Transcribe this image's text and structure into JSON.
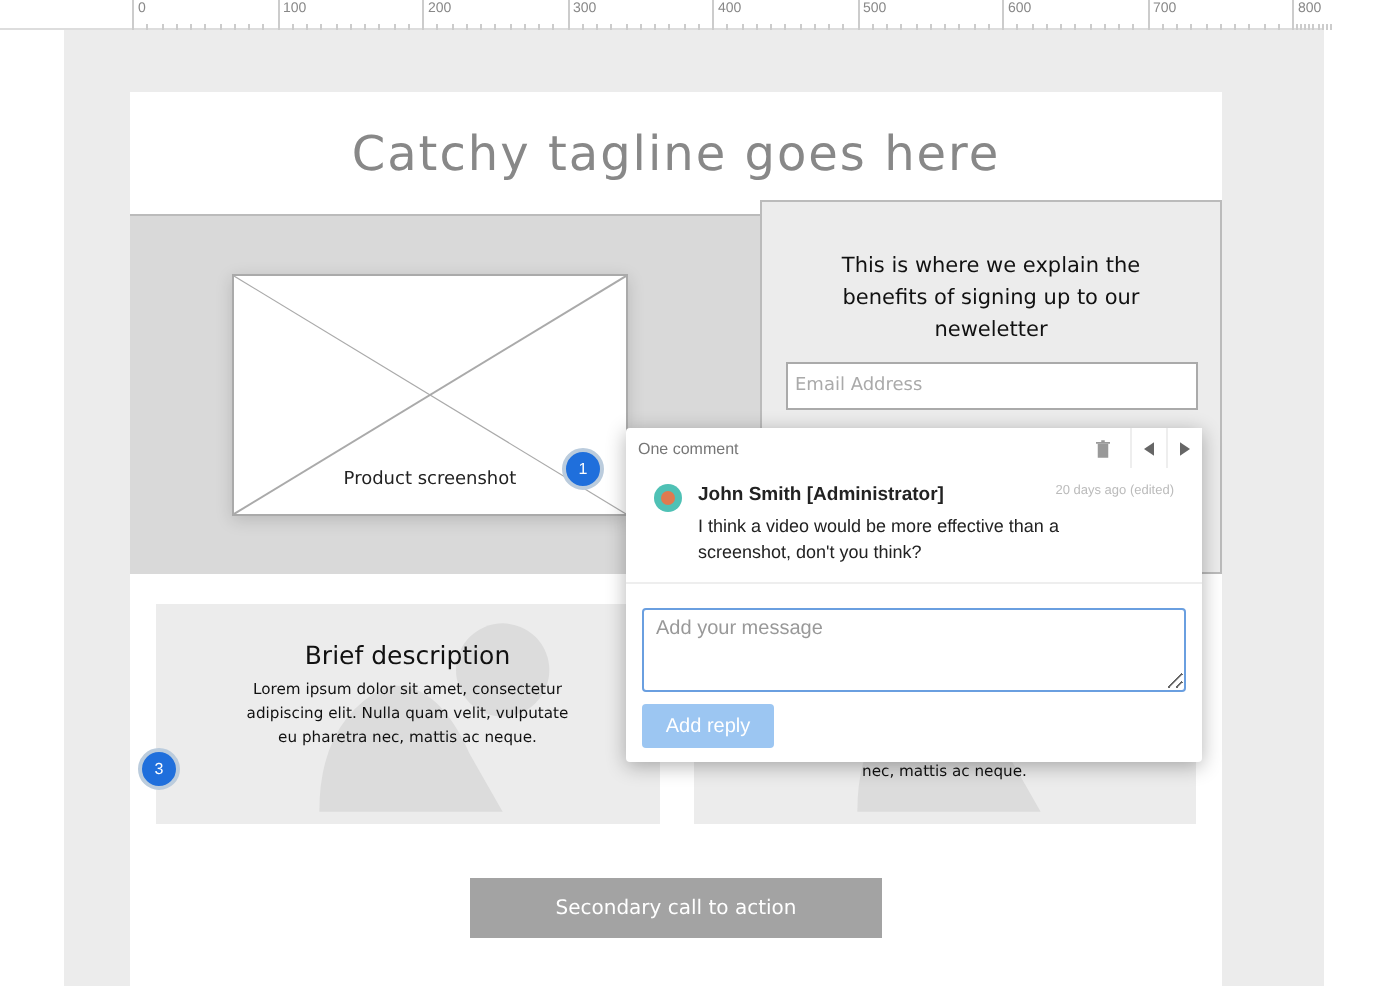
{
  "ruler": {
    "labels": [
      "0",
      "100",
      "200",
      "300",
      "400",
      "500",
      "600",
      "700",
      "800"
    ]
  },
  "page": {
    "tagline": "Catchy tagline goes here",
    "hero": {
      "image_caption": "Product screenshot",
      "marker": "1",
      "newsletter": {
        "text": "This is where we explain the benefits of signing up to our neweletter",
        "email_placeholder": "Email Address"
      }
    },
    "cards": [
      {
        "title": "Brief description",
        "text": "Lorem ipsum dolor sit amet, consectetur adipiscing elit. Nulla quam velit, vulputate eu pharetra nec, mattis ac neque."
      },
      {
        "text": "nec, mattis ac neque."
      }
    ],
    "card_marker": "3",
    "cta": "Secondary call to action"
  },
  "comment_popover": {
    "header": "One comment",
    "comments": [
      {
        "author": "John Smith [Administrator]",
        "time": "20 days ago (edited)",
        "text": "I think a video would be more effective than a screenshot, don't you think?"
      }
    ],
    "reply_placeholder": "Add your message",
    "reply_button": {
      "label": "Add reply",
      "disabled": true
    }
  }
}
